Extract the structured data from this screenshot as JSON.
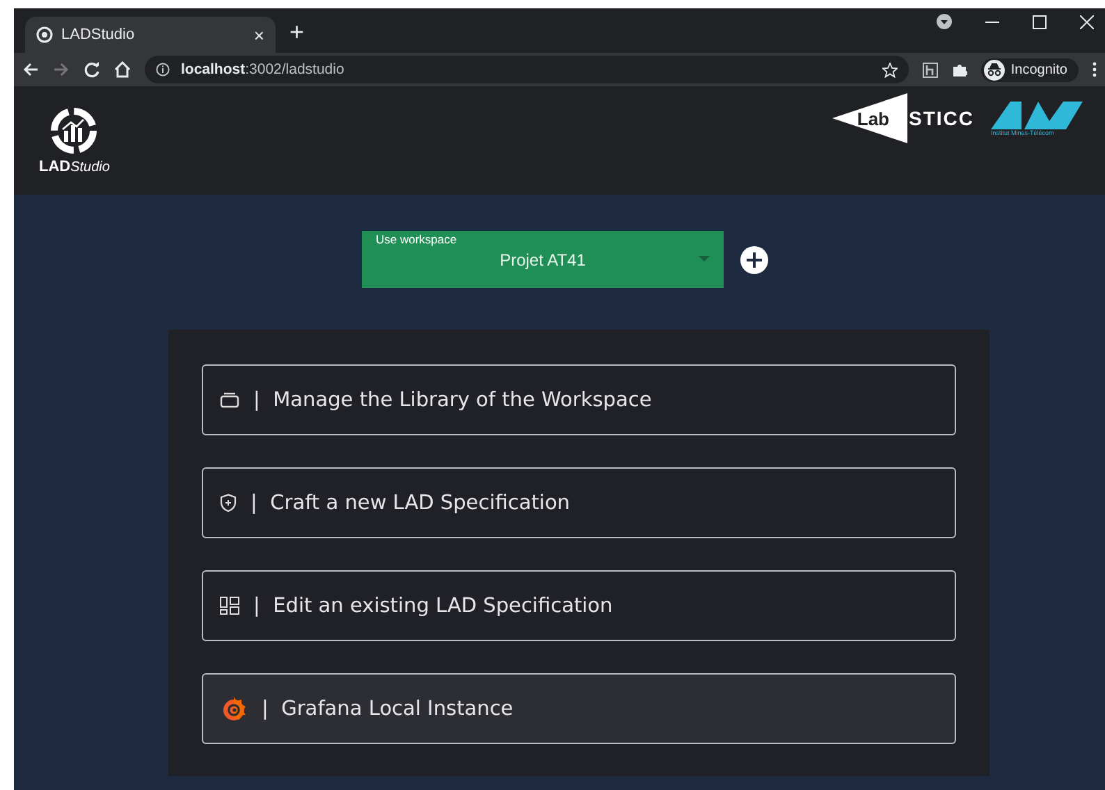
{
  "browser": {
    "tab_title": "LADStudio",
    "tab_close": "×",
    "new_tab": "+",
    "url": "**localhost**:3002/ladstudio",
    "profile": "Incognito"
  },
  "header": {
    "logo_bold": "LAD",
    "logo_italic": "Studio",
    "partner_logos": [
      {
        "kind": "labsticc",
        "text_left": "Lab",
        "text_right": "STICC"
      },
      {
        "kind": "imt",
        "caption": "Institut Mines-Télécom"
      }
    ]
  },
  "workspace": {
    "label": "Use workspace",
    "value": "Projet AT41"
  },
  "actions": [
    {
      "separator": "|",
      "label": "Manage the Library of the Workspace",
      "highlighted": false
    },
    {
      "separator": "|",
      "label": "Craft a new LAD Specification",
      "highlighted": false
    },
    {
      "separator": "|",
      "label": "Edit an existing LAD Specification",
      "highlighted": false
    },
    {
      "separator": "|",
      "label": "Grafana Local Instance",
      "highlighted": true
    }
  ]
}
